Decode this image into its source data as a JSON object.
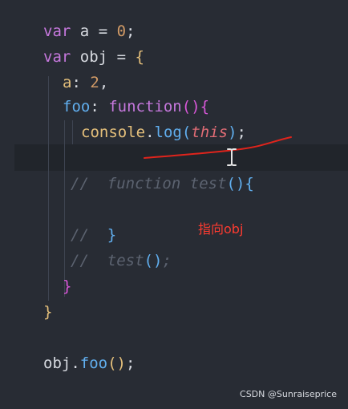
{
  "code": {
    "line1": {
      "kw": "var",
      "ident": "a",
      "op": "=",
      "num": "0",
      "end": ";"
    },
    "line2": {
      "kw": "var",
      "ident": "obj",
      "op": "=",
      "brace": "{"
    },
    "line3": {
      "key": "a",
      "colon": ":",
      "num": "2",
      "comma": ","
    },
    "line4": {
      "key": "foo",
      "colon": ":",
      "kw": "function",
      "parens": "()",
      "brace": "{"
    },
    "line5": {
      "obj": "console",
      "dot": ".",
      "method": "log",
      "open": "(",
      "arg": "this",
      "close": ")",
      "end": ";"
    },
    "line7": {
      "comment": "//",
      "kw": "function",
      "name": "test",
      "parens": "()",
      "brace": "{"
    },
    "line9": {
      "comment": "//",
      "brace": "}"
    },
    "line10": {
      "comment": "//",
      "name": "test",
      "parens": "()",
      "end": ";"
    },
    "line11": {
      "brace": "}"
    },
    "line12": {
      "brace": "}"
    },
    "line14": {
      "obj": "obj",
      "dot": ".",
      "method": "foo",
      "parens": "()",
      "end": ";"
    }
  },
  "annotation": {
    "text": "指向obj",
    "color": "#ff3b30"
  },
  "watermark": {
    "text": "CSDN @Sunraiseprice"
  },
  "icons": {
    "text_cursor": "i-beam-cursor-icon"
  },
  "colors": {
    "background": "#282c34",
    "keyword": "#c678dd",
    "function": "#61afef",
    "number": "#d19a66",
    "this": "#e06c75",
    "comment": "#5c6370"
  }
}
